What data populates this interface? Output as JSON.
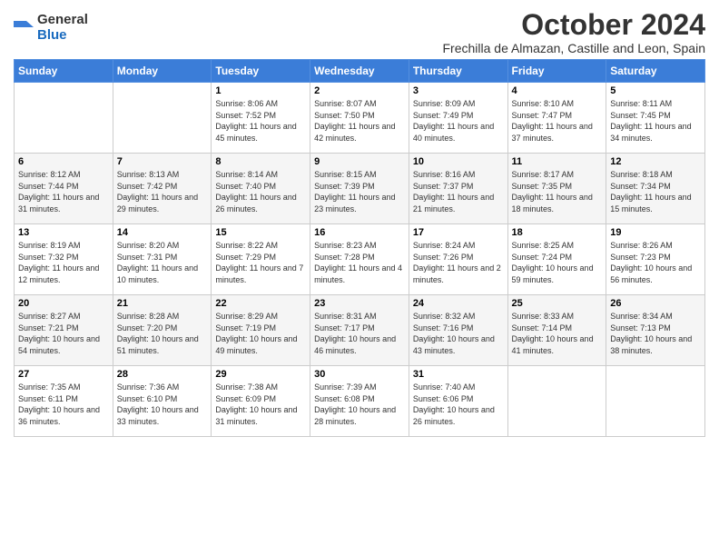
{
  "logo": {
    "general": "General",
    "blue": "Blue"
  },
  "title": "October 2024",
  "location": "Frechilla de Almazan, Castille and Leon, Spain",
  "weekdays": [
    "Sunday",
    "Monday",
    "Tuesday",
    "Wednesday",
    "Thursday",
    "Friday",
    "Saturday"
  ],
  "weeks": [
    [
      {
        "day": "",
        "info": ""
      },
      {
        "day": "",
        "info": ""
      },
      {
        "day": "1",
        "info": "Sunrise: 8:06 AM\nSunset: 7:52 PM\nDaylight: 11 hours and 45 minutes."
      },
      {
        "day": "2",
        "info": "Sunrise: 8:07 AM\nSunset: 7:50 PM\nDaylight: 11 hours and 42 minutes."
      },
      {
        "day": "3",
        "info": "Sunrise: 8:09 AM\nSunset: 7:49 PM\nDaylight: 11 hours and 40 minutes."
      },
      {
        "day": "4",
        "info": "Sunrise: 8:10 AM\nSunset: 7:47 PM\nDaylight: 11 hours and 37 minutes."
      },
      {
        "day": "5",
        "info": "Sunrise: 8:11 AM\nSunset: 7:45 PM\nDaylight: 11 hours and 34 minutes."
      }
    ],
    [
      {
        "day": "6",
        "info": "Sunrise: 8:12 AM\nSunset: 7:44 PM\nDaylight: 11 hours and 31 minutes."
      },
      {
        "day": "7",
        "info": "Sunrise: 8:13 AM\nSunset: 7:42 PM\nDaylight: 11 hours and 29 minutes."
      },
      {
        "day": "8",
        "info": "Sunrise: 8:14 AM\nSunset: 7:40 PM\nDaylight: 11 hours and 26 minutes."
      },
      {
        "day": "9",
        "info": "Sunrise: 8:15 AM\nSunset: 7:39 PM\nDaylight: 11 hours and 23 minutes."
      },
      {
        "day": "10",
        "info": "Sunrise: 8:16 AM\nSunset: 7:37 PM\nDaylight: 11 hours and 21 minutes."
      },
      {
        "day": "11",
        "info": "Sunrise: 8:17 AM\nSunset: 7:35 PM\nDaylight: 11 hours and 18 minutes."
      },
      {
        "day": "12",
        "info": "Sunrise: 8:18 AM\nSunset: 7:34 PM\nDaylight: 11 hours and 15 minutes."
      }
    ],
    [
      {
        "day": "13",
        "info": "Sunrise: 8:19 AM\nSunset: 7:32 PM\nDaylight: 11 hours and 12 minutes."
      },
      {
        "day": "14",
        "info": "Sunrise: 8:20 AM\nSunset: 7:31 PM\nDaylight: 11 hours and 10 minutes."
      },
      {
        "day": "15",
        "info": "Sunrise: 8:22 AM\nSunset: 7:29 PM\nDaylight: 11 hours and 7 minutes."
      },
      {
        "day": "16",
        "info": "Sunrise: 8:23 AM\nSunset: 7:28 PM\nDaylight: 11 hours and 4 minutes."
      },
      {
        "day": "17",
        "info": "Sunrise: 8:24 AM\nSunset: 7:26 PM\nDaylight: 11 hours and 2 minutes."
      },
      {
        "day": "18",
        "info": "Sunrise: 8:25 AM\nSunset: 7:24 PM\nDaylight: 10 hours and 59 minutes."
      },
      {
        "day": "19",
        "info": "Sunrise: 8:26 AM\nSunset: 7:23 PM\nDaylight: 10 hours and 56 minutes."
      }
    ],
    [
      {
        "day": "20",
        "info": "Sunrise: 8:27 AM\nSunset: 7:21 PM\nDaylight: 10 hours and 54 minutes."
      },
      {
        "day": "21",
        "info": "Sunrise: 8:28 AM\nSunset: 7:20 PM\nDaylight: 10 hours and 51 minutes."
      },
      {
        "day": "22",
        "info": "Sunrise: 8:29 AM\nSunset: 7:19 PM\nDaylight: 10 hours and 49 minutes."
      },
      {
        "day": "23",
        "info": "Sunrise: 8:31 AM\nSunset: 7:17 PM\nDaylight: 10 hours and 46 minutes."
      },
      {
        "day": "24",
        "info": "Sunrise: 8:32 AM\nSunset: 7:16 PM\nDaylight: 10 hours and 43 minutes."
      },
      {
        "day": "25",
        "info": "Sunrise: 8:33 AM\nSunset: 7:14 PM\nDaylight: 10 hours and 41 minutes."
      },
      {
        "day": "26",
        "info": "Sunrise: 8:34 AM\nSunset: 7:13 PM\nDaylight: 10 hours and 38 minutes."
      }
    ],
    [
      {
        "day": "27",
        "info": "Sunrise: 7:35 AM\nSunset: 6:11 PM\nDaylight: 10 hours and 36 minutes."
      },
      {
        "day": "28",
        "info": "Sunrise: 7:36 AM\nSunset: 6:10 PM\nDaylight: 10 hours and 33 minutes."
      },
      {
        "day": "29",
        "info": "Sunrise: 7:38 AM\nSunset: 6:09 PM\nDaylight: 10 hours and 31 minutes."
      },
      {
        "day": "30",
        "info": "Sunrise: 7:39 AM\nSunset: 6:08 PM\nDaylight: 10 hours and 28 minutes."
      },
      {
        "day": "31",
        "info": "Sunrise: 7:40 AM\nSunset: 6:06 PM\nDaylight: 10 hours and 26 minutes."
      },
      {
        "day": "",
        "info": ""
      },
      {
        "day": "",
        "info": ""
      }
    ]
  ]
}
